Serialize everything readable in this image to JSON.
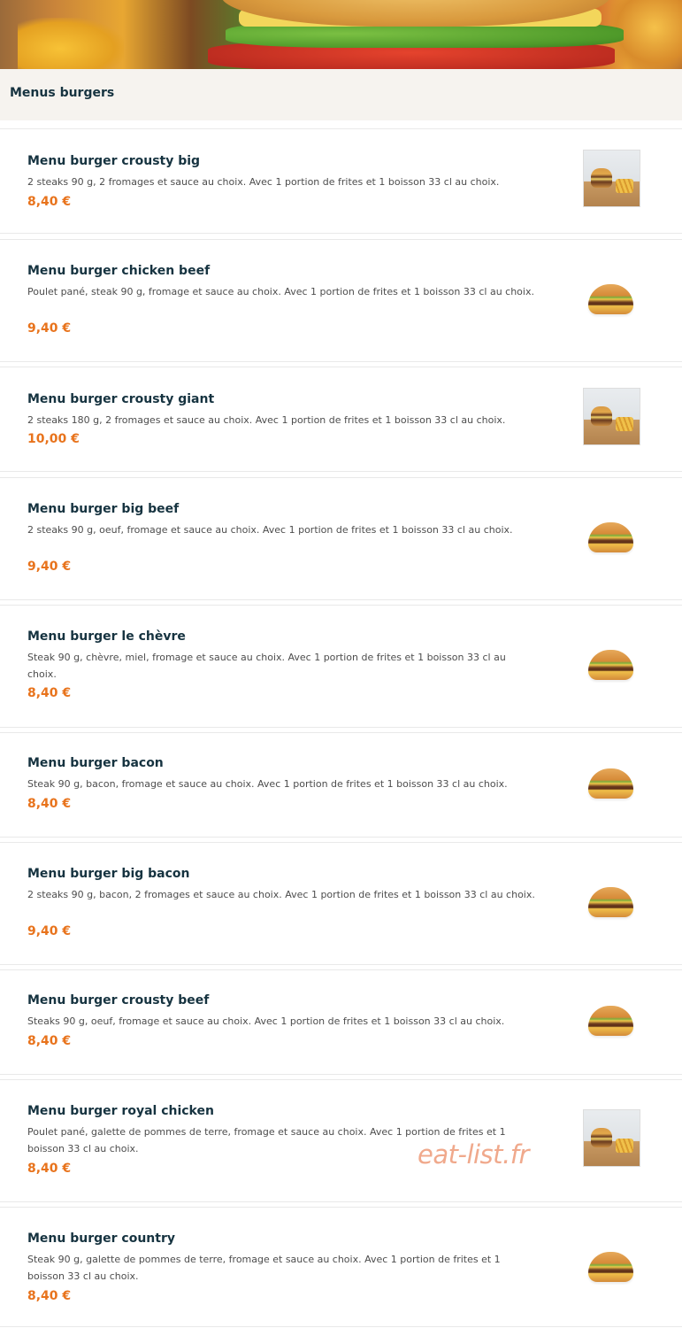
{
  "section": {
    "title": "Menus burgers"
  },
  "items": [
    {
      "name": "Menu burger crousty big",
      "description": "2 steaks 90 g, 2 fromages et sauce au choix. Avec 1 portion de frites et 1 boisson 33 cl au choix.",
      "price": "8,40 €",
      "image": "burger-fries-photo"
    },
    {
      "name": "Menu burger chicken beef",
      "description": "Poulet pané, steak 90 g, fromage et sauce au choix. Avec 1 portion de frites et 1 boisson 33 cl au choix.",
      "price": "9,40 €",
      "image": "burger-photo"
    },
    {
      "name": "Menu burger crousty giant",
      "description": "2 steaks 180 g, 2 fromages et sauce au choix. Avec 1 portion de frites et 1 boisson 33 cl au choix.",
      "price": "10,00 €",
      "image": "burger-fries-photo"
    },
    {
      "name": "Menu burger big beef",
      "description": "2 steaks 90 g, oeuf, fromage et sauce au choix. Avec 1 portion de frites et 1 boisson 33 cl au choix.",
      "price": "9,40 €",
      "image": "burger-photo"
    },
    {
      "name": "Menu burger le chèvre",
      "description": "Steak 90 g, chèvre, miel, fromage et sauce au choix. Avec 1 portion de frites et 1 boisson 33 cl au choix.",
      "price": "8,40 €",
      "image": "burger-photo"
    },
    {
      "name": "Menu burger bacon",
      "description": "Steak 90 g, bacon, fromage et sauce au choix. Avec 1 portion de frites et 1 boisson 33 cl au choix.",
      "price": "8,40 €",
      "image": "burger-photo"
    },
    {
      "name": "Menu burger big bacon",
      "description": "2 steaks 90 g, bacon, 2 fromages et sauce au choix. Avec 1 portion de frites et 1 boisson 33 cl au choix.",
      "price": "9,40 €",
      "image": "burger-photo"
    },
    {
      "name": "Menu burger crousty beef",
      "description": "Steaks 90 g, oeuf, fromage et sauce au choix. Avec 1 portion de frites et 1 boisson 33 cl au choix.",
      "price": "8,40 €",
      "image": "burger-photo"
    },
    {
      "name": "Menu burger royal chicken",
      "description": "Poulet pané, galette de pommes de terre, fromage et sauce au choix. Avec 1 portion de frites et 1 boisson 33 cl au choix.",
      "price": "8,40 €",
      "image": "burger-fries-photo"
    },
    {
      "name": "Menu burger country",
      "description": "Steak 90 g, galette de pommes de terre, fromage et sauce au choix. Avec 1 portion de frites et 1 boisson 33 cl au choix.",
      "price": "8,40 €",
      "image": "burger-photo"
    }
  ],
  "watermark": "eat-list.fr"
}
